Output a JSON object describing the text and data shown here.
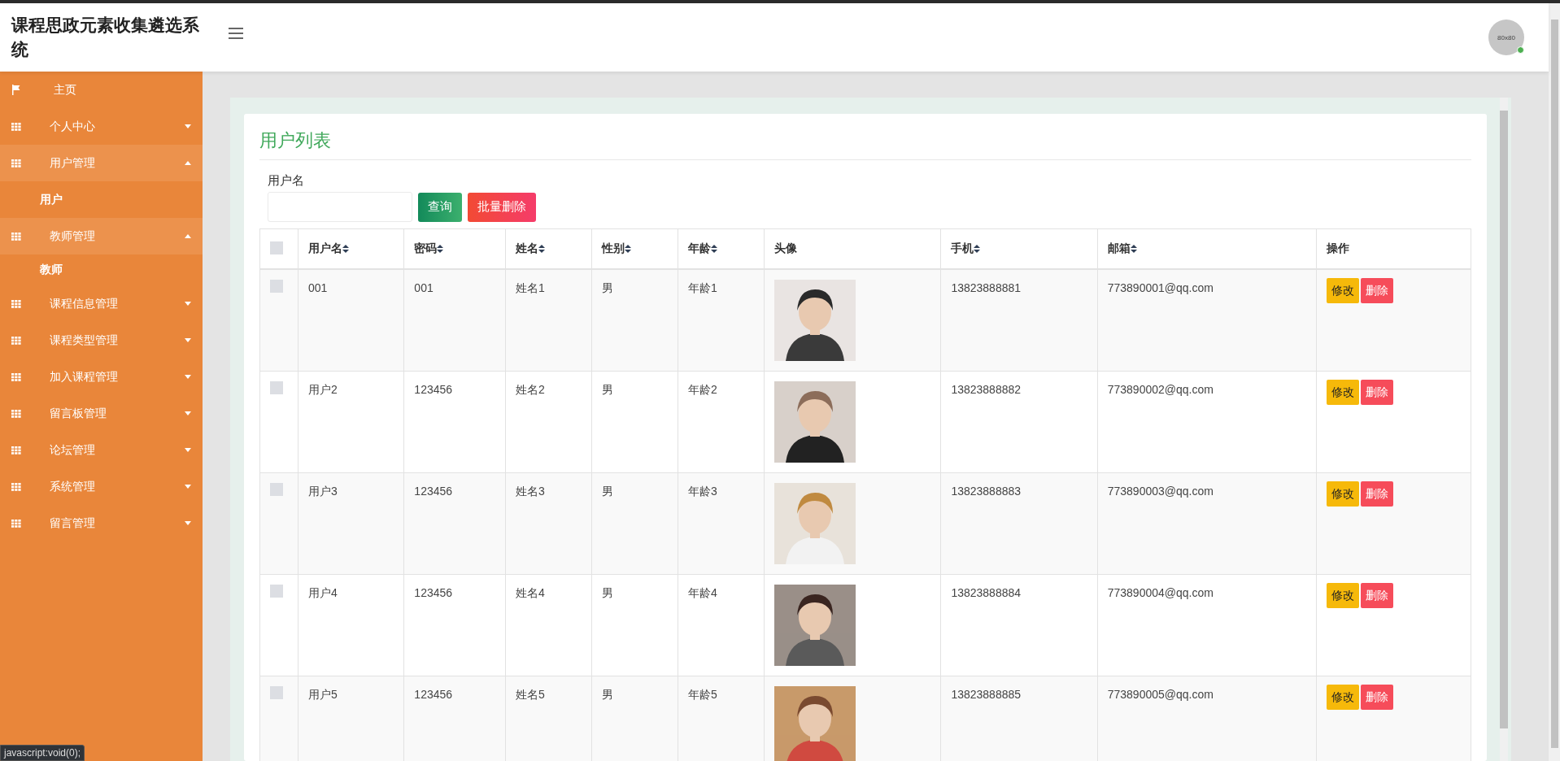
{
  "header": {
    "title": "课程思政元素收集遴选系统",
    "avatar": {
      "label": "80x80",
      "online": true
    }
  },
  "sidebar": {
    "items": [
      {
        "label": "主页",
        "kind": "link"
      },
      {
        "label": "个人中心",
        "kind": "menu",
        "expanded": false,
        "highlighted": false
      },
      {
        "label": "用户管理",
        "kind": "menu",
        "expanded": true,
        "highlighted": true,
        "children": [
          {
            "label": "用户"
          }
        ]
      },
      {
        "label": "教师管理",
        "kind": "menu",
        "expanded": true,
        "highlighted": true,
        "children": [
          {
            "label": "教师"
          }
        ]
      },
      {
        "label": "课程信息管理",
        "kind": "menu",
        "expanded": false,
        "highlighted": false
      },
      {
        "label": "课程类型管理",
        "kind": "menu",
        "expanded": false,
        "highlighted": false
      },
      {
        "label": "加入课程管理",
        "kind": "menu",
        "expanded": false,
        "highlighted": false
      },
      {
        "label": "留言板管理",
        "kind": "menu",
        "expanded": false,
        "highlighted": false
      },
      {
        "label": "论坛管理",
        "kind": "menu",
        "expanded": false,
        "highlighted": false
      },
      {
        "label": "系统管理",
        "kind": "menu",
        "expanded": false,
        "highlighted": false
      },
      {
        "label": "留言管理",
        "kind": "menu",
        "expanded": false,
        "highlighted": false
      }
    ]
  },
  "panel": {
    "title": "用户列表",
    "search": {
      "label": "用户名"
    },
    "buttons": [
      {
        "label": "查询",
        "kind": "search"
      },
      {
        "label": "批量删除",
        "kind": "danger"
      }
    ],
    "table": {
      "columns": [
        {
          "kind": "checkbox",
          "checked": false
        },
        {
          "label": "用户名",
          "sortable": true
        },
        {
          "label": "密码",
          "sortable": true
        },
        {
          "label": "姓名",
          "sortable": true
        },
        {
          "label": "性别",
          "sortable": true
        },
        {
          "label": "年龄",
          "sortable": true
        },
        {
          "label": "头像",
          "sortable": false
        },
        {
          "label": "手机",
          "sortable": true
        },
        {
          "label": "邮箱",
          "sortable": true
        },
        {
          "label": "操作",
          "sortable": false
        }
      ],
      "rows": [
        {
          "checked": false,
          "username": "001",
          "password": "001",
          "name": "姓名1",
          "gender": "男",
          "age": "年龄1",
          "phone": "13823888881",
          "email": "773890001@qq.com",
          "actions": [
            {
              "label": "修改",
              "kind": "edit"
            },
            {
              "label": "删除",
              "kind": "delete"
            }
          ]
        },
        {
          "checked": false,
          "username": "用户2",
          "password": "123456",
          "name": "姓名2",
          "gender": "男",
          "age": "年龄2",
          "phone": "13823888882",
          "email": "773890002@qq.com",
          "actions": [
            {
              "label": "修改",
              "kind": "edit"
            },
            {
              "label": "删除",
              "kind": "delete"
            }
          ]
        },
        {
          "checked": false,
          "username": "用户3",
          "password": "123456",
          "name": "姓名3",
          "gender": "男",
          "age": "年龄3",
          "phone": "13823888883",
          "email": "773890003@qq.com",
          "actions": [
            {
              "label": "修改",
              "kind": "edit"
            },
            {
              "label": "删除",
              "kind": "delete"
            }
          ]
        },
        {
          "checked": false,
          "username": "用户4",
          "password": "123456",
          "name": "姓名4",
          "gender": "男",
          "age": "年龄4",
          "phone": "13823888884",
          "email": "773890004@qq.com",
          "actions": [
            {
              "label": "修改",
              "kind": "edit"
            },
            {
              "label": "删除",
              "kind": "delete"
            }
          ]
        },
        {
          "checked": false,
          "username": "用户5",
          "password": "123456",
          "name": "姓名5",
          "gender": "男",
          "age": "年龄5",
          "phone": "13823888885",
          "email": "773890005@qq.com",
          "actions": [
            {
              "label": "修改",
              "kind": "edit"
            },
            {
              "label": "删除",
              "kind": "delete"
            }
          ]
        }
      ]
    }
  },
  "status_bar": {
    "text": "javascript:void(0);"
  }
}
